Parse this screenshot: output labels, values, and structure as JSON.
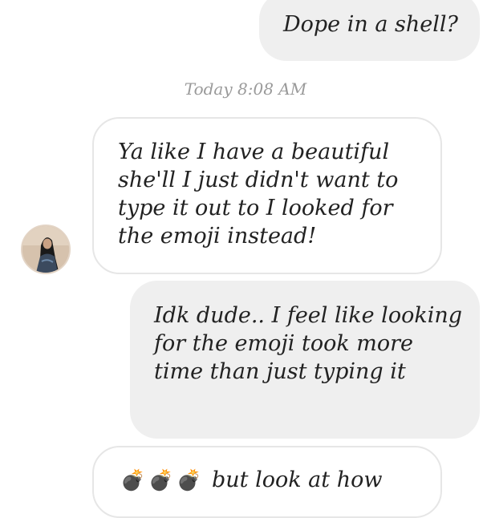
{
  "conversation": {
    "timestamp": "Today 8:08 AM",
    "messages": [
      {
        "direction": "sent",
        "text": "Dope in a shell?"
      },
      {
        "direction": "received",
        "text": "Ya like I have a beautiful she'll I just didn't want to type it out to I looked for the emoji instead!"
      },
      {
        "direction": "sent",
        "text": "Idk dude.. I feel like looking for the emoji took more time than just typing it"
      },
      {
        "direction": "received",
        "emoji": "💣💣💣",
        "emoji_icon": "bomb-emoji",
        "text": "but look at how"
      }
    ]
  },
  "avatar": {
    "icon": "contact-avatar-photo",
    "colors": {
      "background": "#d6c2ad",
      "hair": "#1a1a1a",
      "clothing": "#3b4a5e"
    }
  }
}
